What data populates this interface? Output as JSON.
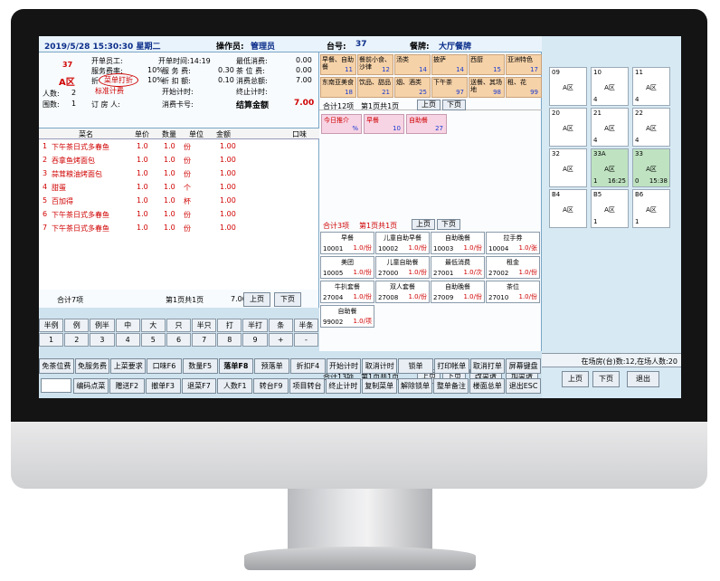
{
  "header": {
    "datetime": "2019/5/28 15:30:30 星期二",
    "operator_label": "操作员:",
    "operator": "管理员",
    "table_label": "台号:",
    "table": "37",
    "segment_label": "餐牌:",
    "segment": "大厅餐牌"
  },
  "info": {
    "table_no": "37",
    "area": "A区",
    "open_staff_label": "开单员工:",
    "open_time_label": "开单时间:14:19",
    "min_consume_label": "最低消费:",
    "min_consume": "0.00",
    "service_rate_label": "服务费率:",
    "service_rate": "10%",
    "service_fee_label": "服 务 费:",
    "service_fee": "0.30",
    "tea_label": "茶 位 费:",
    "tea": "0.00",
    "discount_label": "折",
    "discount_circle": "菜单打折",
    "discount_rate": "10%",
    "discount_amt_label": "折 扣 额:",
    "discount_amt": "0.10",
    "consume_total_label": "消费总额:",
    "consume_total": "7.00",
    "standard_label": "标准计费",
    "people_label": "人数:",
    "people": "2",
    "table_count_label": "围数:",
    "table_count": "1",
    "booker_label": "订 房 人:",
    "start_time_label": "开始计时:",
    "end_time_label": "终止计时:",
    "card_label": "消费卡号:",
    "settle_label": "结算金额",
    "settle": "7.00"
  },
  "order": {
    "cols": [
      "菜名",
      "单价",
      "数量",
      "单位",
      "金额",
      "口味"
    ],
    "rows": [
      {
        "name": "下午茶日式多春鱼",
        "price": "1.0",
        "qty": "1.0",
        "unit": "份",
        "amount": "1.00"
      },
      {
        "name": "吞拿鱼烤面包",
        "price": "1.0",
        "qty": "1.0",
        "unit": "份",
        "amount": "1.00"
      },
      {
        "name": "蒜茸粮油烤面包",
        "price": "1.0",
        "qty": "1.0",
        "unit": "份",
        "amount": "1.00"
      },
      {
        "name": "甜蛋",
        "price": "1.0",
        "qty": "1.0",
        "unit": "个",
        "amount": "1.00"
      },
      {
        "name": "百加得",
        "price": "1.0",
        "qty": "1.0",
        "unit": "杯",
        "amount": "1.00"
      },
      {
        "name": "下午茶日式多春鱼",
        "price": "1.0",
        "qty": "1.0",
        "unit": "份",
        "amount": "1.00"
      },
      {
        "name": "下午茶日式多春鱼",
        "price": "1.0",
        "qty": "1.0",
        "unit": "份",
        "amount": "1.00"
      }
    ],
    "total_items": "合计7项",
    "page_info": "第1页共1页",
    "total_amount": "7.00",
    "prev": "上页",
    "next": "下页"
  },
  "keypad": {
    "row1": [
      "半例",
      "例",
      "例半",
      "中",
      "大",
      "只",
      "半只",
      "打",
      "半打",
      "条",
      "半条"
    ],
    "row2": [
      "1",
      "2",
      "3",
      "4",
      "5",
      "6",
      "7",
      "8",
      "9",
      "+",
      "-"
    ]
  },
  "categories": {
    "row1": [
      {
        "name": "早餐、自助餐",
        "n": "11"
      },
      {
        "name": "餐前小食、沙律",
        "n": "12"
      },
      {
        "name": "汤类",
        "n": "14"
      },
      {
        "name": "披萨",
        "n": "14"
      },
      {
        "name": "西厨",
        "n": "15"
      },
      {
        "name": "亚洲特色",
        "n": "17"
      }
    ],
    "row2": [
      {
        "name": "东南亚美食",
        "n": "18"
      },
      {
        "name": "饮品、甜品",
        "n": "21"
      },
      {
        "name": "烟、酒类",
        "n": "25"
      },
      {
        "name": "下午茶",
        "n": "97"
      },
      {
        "name": "送餐、其场地",
        "n": "98"
      },
      {
        "name": "租、花",
        "n": "99"
      }
    ],
    "total": "合计12项",
    "page_info": "第1页共1页",
    "prev": "上页",
    "next": "下页"
  },
  "packages": {
    "items": [
      {
        "name": "今日推介",
        "n": "%"
      },
      {
        "name": "早餐",
        "n": "10"
      },
      {
        "name": "自助餐",
        "n": "27"
      }
    ],
    "total": "合计3项",
    "page_info": "第1页共1页",
    "prev": "上页",
    "next": "下页"
  },
  "dishes": {
    "items": [
      {
        "name": "早餐",
        "code": "10001",
        "price": "1.0/份"
      },
      {
        "name": "儿童自助早餐",
        "code": "10002",
        "price": "1.0/份"
      },
      {
        "name": "自助晚餐",
        "code": "10003",
        "price": "1.0/份"
      },
      {
        "name": "拉手券",
        "code": "10004",
        "price": "1.0/张"
      },
      {
        "name": "美团",
        "code": "10005",
        "price": "1.0/份"
      },
      {
        "name": "儿童自助餐",
        "code": "27000",
        "price": "1.0/份"
      },
      {
        "name": "最低消费",
        "code": "27001",
        "price": "1.0/次"
      },
      {
        "name": "租金",
        "code": "27002",
        "price": "1.0/份"
      },
      {
        "name": "牛扒套餐",
        "code": "27004",
        "price": "1.0/份"
      },
      {
        "name": "双人套餐",
        "code": "27008",
        "price": "1.0/份"
      },
      {
        "name": "自助晚餐",
        "code": "27009",
        "price": "1.0/份"
      },
      {
        "name": "茶位",
        "code": "27010",
        "price": "1.0/份"
      },
      {
        "name": "自助餐",
        "code": "99002",
        "price": "1.0/项"
      }
    ],
    "total": "合计13项",
    "page_info": "第1页共1页",
    "prev": "上页",
    "next": "下页",
    "modify": "改菜谱",
    "add": "加菜谱"
  },
  "tables": [
    {
      "no": "09",
      "area": "A区",
      "guests": "",
      "time": "",
      "busy": false
    },
    {
      "no": "10",
      "area": "A区",
      "guests": "4",
      "time": "",
      "busy": false
    },
    {
      "no": "11",
      "area": "A区",
      "guests": "4",
      "time": "",
      "busy": false
    },
    {
      "no": "20",
      "area": "A区",
      "guests": "",
      "time": "",
      "busy": false
    },
    {
      "no": "21",
      "area": "A区",
      "guests": "4",
      "time": "",
      "busy": false
    },
    {
      "no": "22",
      "area": "A区",
      "guests": "4",
      "time": "",
      "busy": false
    },
    {
      "no": "32",
      "area": "A区",
      "guests": "",
      "time": "",
      "busy": false
    },
    {
      "no": "33A",
      "area": "A区",
      "guests": "1",
      "time": "16:25",
      "busy": true
    },
    {
      "no": "33",
      "area": "A区",
      "guests": "0",
      "time": "15:38",
      "busy": true
    },
    {
      "no": "B4",
      "area": "A区",
      "guests": "",
      "time": "",
      "busy": false
    },
    {
      "no": "B5",
      "area": "A区",
      "guests": "1",
      "time": "",
      "busy": false
    },
    {
      "no": "B6",
      "area": "A区",
      "guests": "1",
      "time": "",
      "busy": false
    }
  ],
  "right_status": "在场房(台)数:12,在场人数:20",
  "right_buttons": {
    "prev": "上页",
    "next": "下页",
    "exit": "退出"
  },
  "func_row1": [
    "免茶位费",
    "免服务费",
    "上菜要求",
    "口味F6",
    "数量F5",
    "落单F8",
    "预落单",
    "折扣F4",
    "开始计时",
    "取消计时",
    "锁单",
    "打印帐单",
    "取消打单",
    "屏幕键盘"
  ],
  "func_row2": [
    "编码点菜",
    "赠送F2",
    "撤单F3",
    "退菜F7",
    "人数F1",
    "转台F9",
    "项目转台",
    "终止计时",
    "复制菜单",
    "解除锁单",
    "整单备注",
    "楼面总单",
    "退出ESC"
  ]
}
